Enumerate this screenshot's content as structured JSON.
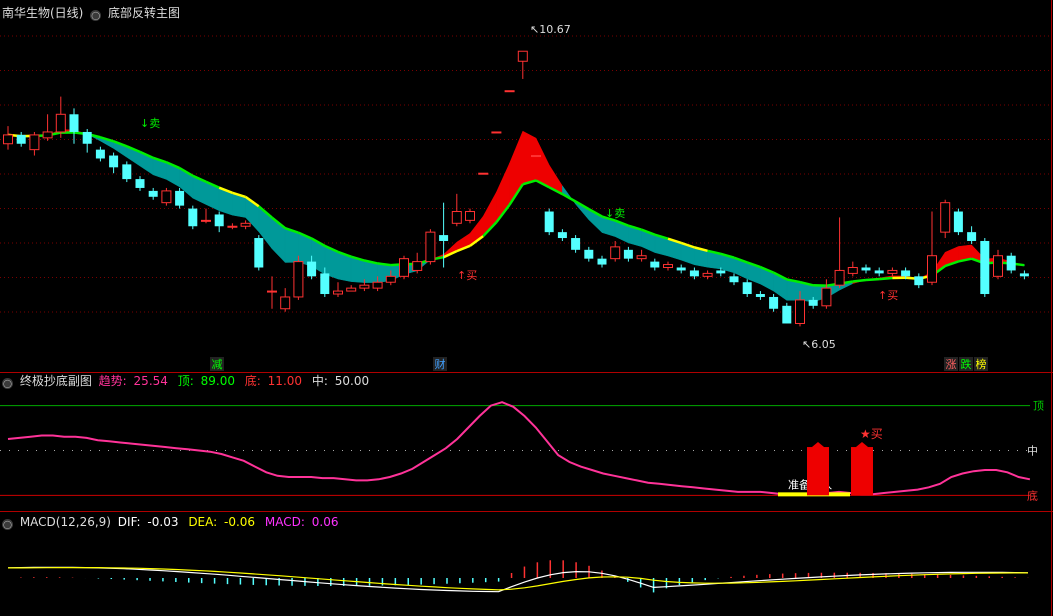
{
  "main": {
    "title": "南华生物(日线)",
    "indicator": "底部反转主图",
    "high_label": "10.67",
    "low_label": "6.05",
    "sell_label": "卖",
    "buy_label": "买",
    "event_marks": [
      {
        "text": "减",
        "color": "#00ff00"
      },
      {
        "text": "财",
        "color": "#40a0ff"
      },
      {
        "text": "涨",
        "color": "#ff6060"
      },
      {
        "text": "跌",
        "color": "#00ff00"
      },
      {
        "text": "榜",
        "color": "#ffff00"
      }
    ]
  },
  "bottom_panel": {
    "title": "终极抄底副图",
    "trend_label": "趋势:",
    "trend_value": "25.54",
    "top_label": "顶:",
    "top_value": "89.00",
    "bottom_label": "底:",
    "bottom_value": "11.00",
    "mid_label": "中:",
    "mid_value": "50.00",
    "right_top": "顶",
    "right_mid": "中",
    "right_bottom": "底",
    "prepare_buy": "准备买入",
    "star_buy": "★买"
  },
  "macd_panel": {
    "title": "MACD(12,26,9)",
    "dif_label": "DIF:",
    "dif_value": "-0.03",
    "dea_label": "DEA:",
    "dea_value": "-0.06",
    "macd_label": "MACD:",
    "macd_value": "0.06"
  },
  "colors": {
    "up": "#ff3232",
    "down": "#54ffff",
    "trend": "#ff3399",
    "dif": "#ffffff",
    "dea": "#ffff00",
    "band_up": "#ee0000",
    "band_down": "#009999"
  },
  "chart_data": [
    {
      "type": "candlestick",
      "title": "南华生物(日线)",
      "price_range": [
        5.6,
        11.2
      ],
      "annotations": [
        {
          "text": "10.67",
          "kind": "high"
        },
        {
          "text": "6.05",
          "kind": "low"
        }
      ],
      "candles": [
        [
          9.1,
          9.25,
          9.4,
          9.0
        ],
        [
          9.25,
          9.1,
          9.3,
          9.05
        ],
        [
          9.0,
          9.25,
          9.3,
          8.9
        ],
        [
          9.2,
          9.3,
          9.6,
          9.15
        ],
        [
          9.3,
          9.6,
          9.9,
          9.2
        ],
        [
          9.6,
          9.3,
          9.7,
          9.1
        ],
        [
          9.3,
          9.1,
          9.35,
          8.95
        ],
        [
          9.0,
          8.85,
          9.05,
          8.8
        ],
        [
          8.9,
          8.7,
          8.95,
          8.6
        ],
        [
          8.75,
          8.5,
          8.8,
          8.45
        ],
        [
          8.5,
          8.35,
          8.55,
          8.3
        ],
        [
          8.3,
          8.2,
          8.35,
          8.15
        ],
        [
          8.1,
          8.3,
          8.35,
          8.05
        ],
        [
          8.3,
          8.05,
          8.35,
          8.0
        ],
        [
          8.0,
          7.7,
          8.05,
          7.65
        ],
        [
          7.8,
          7.8,
          8.0,
          7.75
        ],
        [
          7.9,
          7.7,
          7.95,
          7.6
        ],
        [
          7.7,
          7.7,
          7.75,
          7.65
        ],
        [
          7.7,
          7.75,
          7.8,
          7.65
        ],
        [
          7.5,
          7.0,
          7.55,
          6.95
        ],
        [
          6.6,
          6.6,
          6.85,
          6.3
        ],
        [
          6.3,
          6.5,
          6.65,
          6.25
        ],
        [
          6.5,
          7.1,
          7.2,
          6.45
        ],
        [
          7.1,
          6.85,
          7.2,
          6.8
        ],
        [
          6.9,
          6.55,
          7.0,
          6.5
        ],
        [
          6.55,
          6.6,
          6.75,
          6.5
        ],
        [
          6.6,
          6.65,
          6.7,
          6.6
        ],
        [
          6.65,
          6.7,
          6.8,
          6.6
        ],
        [
          6.65,
          6.75,
          6.85,
          6.6
        ],
        [
          6.75,
          6.85,
          6.95,
          6.7
        ],
        [
          6.85,
          7.15,
          7.2,
          6.8
        ],
        [
          6.95,
          7.1,
          7.25,
          6.9
        ],
        [
          7.1,
          7.6,
          7.65,
          7.05
        ],
        [
          7.55,
          7.45,
          8.1,
          7.0
        ],
        [
          7.75,
          7.95,
          8.25,
          7.7
        ],
        [
          7.8,
          7.95,
          8.0,
          7.75
        ],
        [
          8.6,
          8.6,
          8.6,
          8.6
        ],
        [
          9.3,
          9.3,
          9.3,
          9.3
        ],
        [
          10.0,
          10.0,
          10.0,
          10.0
        ],
        [
          10.5,
          10.67,
          10.67,
          10.2
        ],
        [
          8.9,
          8.9,
          8.9,
          8.9
        ],
        [
          7.95,
          7.6,
          8.0,
          7.55
        ],
        [
          7.6,
          7.5,
          7.65,
          7.45
        ],
        [
          7.5,
          7.3,
          7.55,
          7.25
        ],
        [
          7.3,
          7.15,
          7.35,
          7.1
        ],
        [
          7.15,
          7.05,
          7.2,
          7.0
        ],
        [
          7.15,
          7.35,
          7.45,
          7.1
        ],
        [
          7.3,
          7.15,
          7.35,
          7.1
        ],
        [
          7.15,
          7.2,
          7.3,
          7.1
        ],
        [
          7.1,
          7.0,
          7.15,
          6.95
        ],
        [
          7.0,
          7.05,
          7.1,
          6.95
        ],
        [
          7.0,
          6.95,
          7.05,
          6.9
        ],
        [
          6.95,
          6.85,
          7.0,
          6.8
        ],
        [
          6.85,
          6.9,
          6.95,
          6.8
        ],
        [
          6.95,
          6.9,
          7.0,
          6.85
        ],
        [
          6.85,
          6.75,
          6.9,
          6.7
        ],
        [
          6.75,
          6.55,
          6.8,
          6.5
        ],
        [
          6.55,
          6.5,
          6.6,
          6.45
        ],
        [
          6.5,
          6.3,
          6.55,
          6.25
        ],
        [
          6.35,
          6.05,
          6.4,
          6.05
        ],
        [
          6.05,
          6.45,
          6.6,
          6.0
        ],
        [
          6.45,
          6.35,
          6.5,
          6.3
        ],
        [
          6.35,
          6.65,
          6.8,
          6.3
        ],
        [
          6.7,
          6.95,
          7.85,
          6.65
        ],
        [
          6.9,
          7.0,
          7.1,
          6.85
        ],
        [
          7.0,
          6.95,
          7.05,
          6.9
        ],
        [
          6.95,
          6.9,
          7.0,
          6.85
        ],
        [
          6.9,
          6.95,
          7.0,
          6.85
        ],
        [
          6.95,
          6.85,
          7.0,
          6.8
        ],
        [
          6.85,
          6.7,
          6.9,
          6.65
        ],
        [
          6.75,
          7.2,
          7.95,
          6.7
        ],
        [
          7.6,
          8.1,
          8.15,
          7.5
        ],
        [
          7.95,
          7.6,
          8.0,
          7.55
        ],
        [
          7.6,
          7.45,
          7.7,
          7.4
        ],
        [
          7.45,
          6.55,
          7.5,
          6.5
        ],
        [
          6.85,
          7.2,
          7.3,
          6.8
        ],
        [
          7.2,
          6.95,
          7.25,
          6.9
        ],
        [
          6.9,
          6.85,
          6.95,
          6.8
        ]
      ]
    },
    {
      "type": "line",
      "title": "终极抄底副图",
      "ylim": [
        0,
        100
      ],
      "reference_lines": [
        89,
        50,
        11
      ],
      "series": [
        {
          "name": "趋势",
          "values": [
            60,
            61,
            62,
            63,
            63,
            62,
            62,
            61,
            59,
            58,
            57,
            56,
            55,
            54,
            53,
            52,
            51,
            50,
            49,
            47,
            44,
            41,
            36,
            31,
            28,
            27,
            27,
            27,
            26,
            26,
            25,
            24,
            24,
            25,
            27,
            30,
            34,
            40,
            46,
            52,
            60,
            70,
            80,
            89,
            92,
            88,
            80,
            70,
            58,
            46,
            40,
            36,
            33,
            30,
            28,
            26,
            24,
            22,
            21,
            20,
            19,
            18,
            17,
            16,
            15,
            14,
            14,
            14,
            13,
            12,
            12,
            11,
            12,
            13,
            14,
            13,
            12,
            12,
            13,
            14,
            15,
            16,
            18,
            21,
            27,
            30,
            32,
            33,
            33,
            31,
            27,
            25
          ]
        }
      ],
      "bars": [
        {
          "name": "买",
          "marker": "★买"
        },
        {
          "name": "准备买入"
        }
      ]
    },
    {
      "type": "line",
      "title": "MACD(12,26,9)",
      "series": [
        {
          "name": "DIF",
          "values": [
            -0.03
          ]
        },
        {
          "name": "DEA",
          "values": [
            -0.06
          ]
        },
        {
          "name": "MACD",
          "values": [
            0.06
          ]
        }
      ]
    }
  ]
}
